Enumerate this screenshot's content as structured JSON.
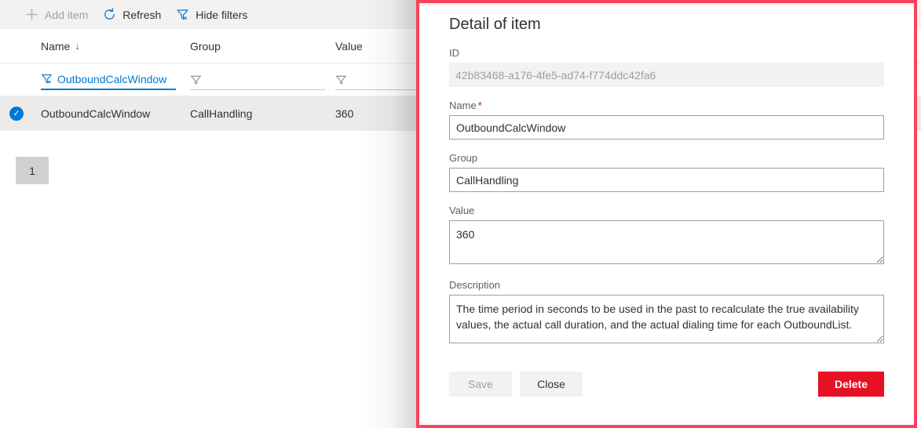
{
  "colors": {
    "accent": "#0078d4",
    "danger": "#e81123",
    "highlight_border": "#f9435a",
    "selected_row": "#edebe9",
    "command_bar": "#f3f2f1"
  },
  "command_bar": {
    "buttons": [
      {
        "label": "Add item",
        "icon": "plus-icon",
        "disabled": true
      },
      {
        "label": "Refresh",
        "icon": "refresh-icon",
        "disabled": false
      },
      {
        "label": "Hide filters",
        "icon": "filter-off-icon",
        "disabled": false
      }
    ]
  },
  "grid": {
    "columns": [
      {
        "key": "name",
        "label": "Name",
        "sorted": true,
        "sort_icon": "↓"
      },
      {
        "key": "group",
        "label": "Group",
        "sorted": false,
        "sort_icon": ""
      },
      {
        "key": "value",
        "label": "Value",
        "sorted": false,
        "sort_icon": ""
      }
    ],
    "filters": {
      "name": {
        "value": "OutboundCalcWindow",
        "active": true,
        "icon": "filter-active-icon"
      },
      "group": {
        "value": "",
        "active": false,
        "icon": "filter-icon"
      },
      "value": {
        "value": "",
        "active": false,
        "icon": "filter-icon"
      }
    },
    "rows": [
      {
        "selected": true,
        "check_icon": "check-circle-icon",
        "name": "OutboundCalcWindow",
        "group": "CallHandling",
        "value": "360"
      }
    ]
  },
  "pager": {
    "current_page": "1"
  },
  "detail_panel": {
    "title": "Detail of item",
    "fields": {
      "id": {
        "label": "ID",
        "value": "42b83468-a176-4fe5-ad74-f774ddc42fa6",
        "readonly": true
      },
      "name": {
        "label": "Name",
        "required_marker": "*",
        "value": "OutboundCalcWindow"
      },
      "group": {
        "label": "Group",
        "value": "CallHandling"
      },
      "value": {
        "label": "Value",
        "value": "360"
      },
      "description": {
        "label": "Description",
        "value": "The time period in seconds to be used in the past to recalculate the true availability values, the actual call duration, and the actual dialing time for each OutboundList."
      }
    },
    "actions": {
      "save": {
        "label": "Save",
        "disabled": true
      },
      "close": {
        "label": "Close",
        "disabled": false
      },
      "delete": {
        "label": "Delete",
        "disabled": false
      }
    }
  }
}
